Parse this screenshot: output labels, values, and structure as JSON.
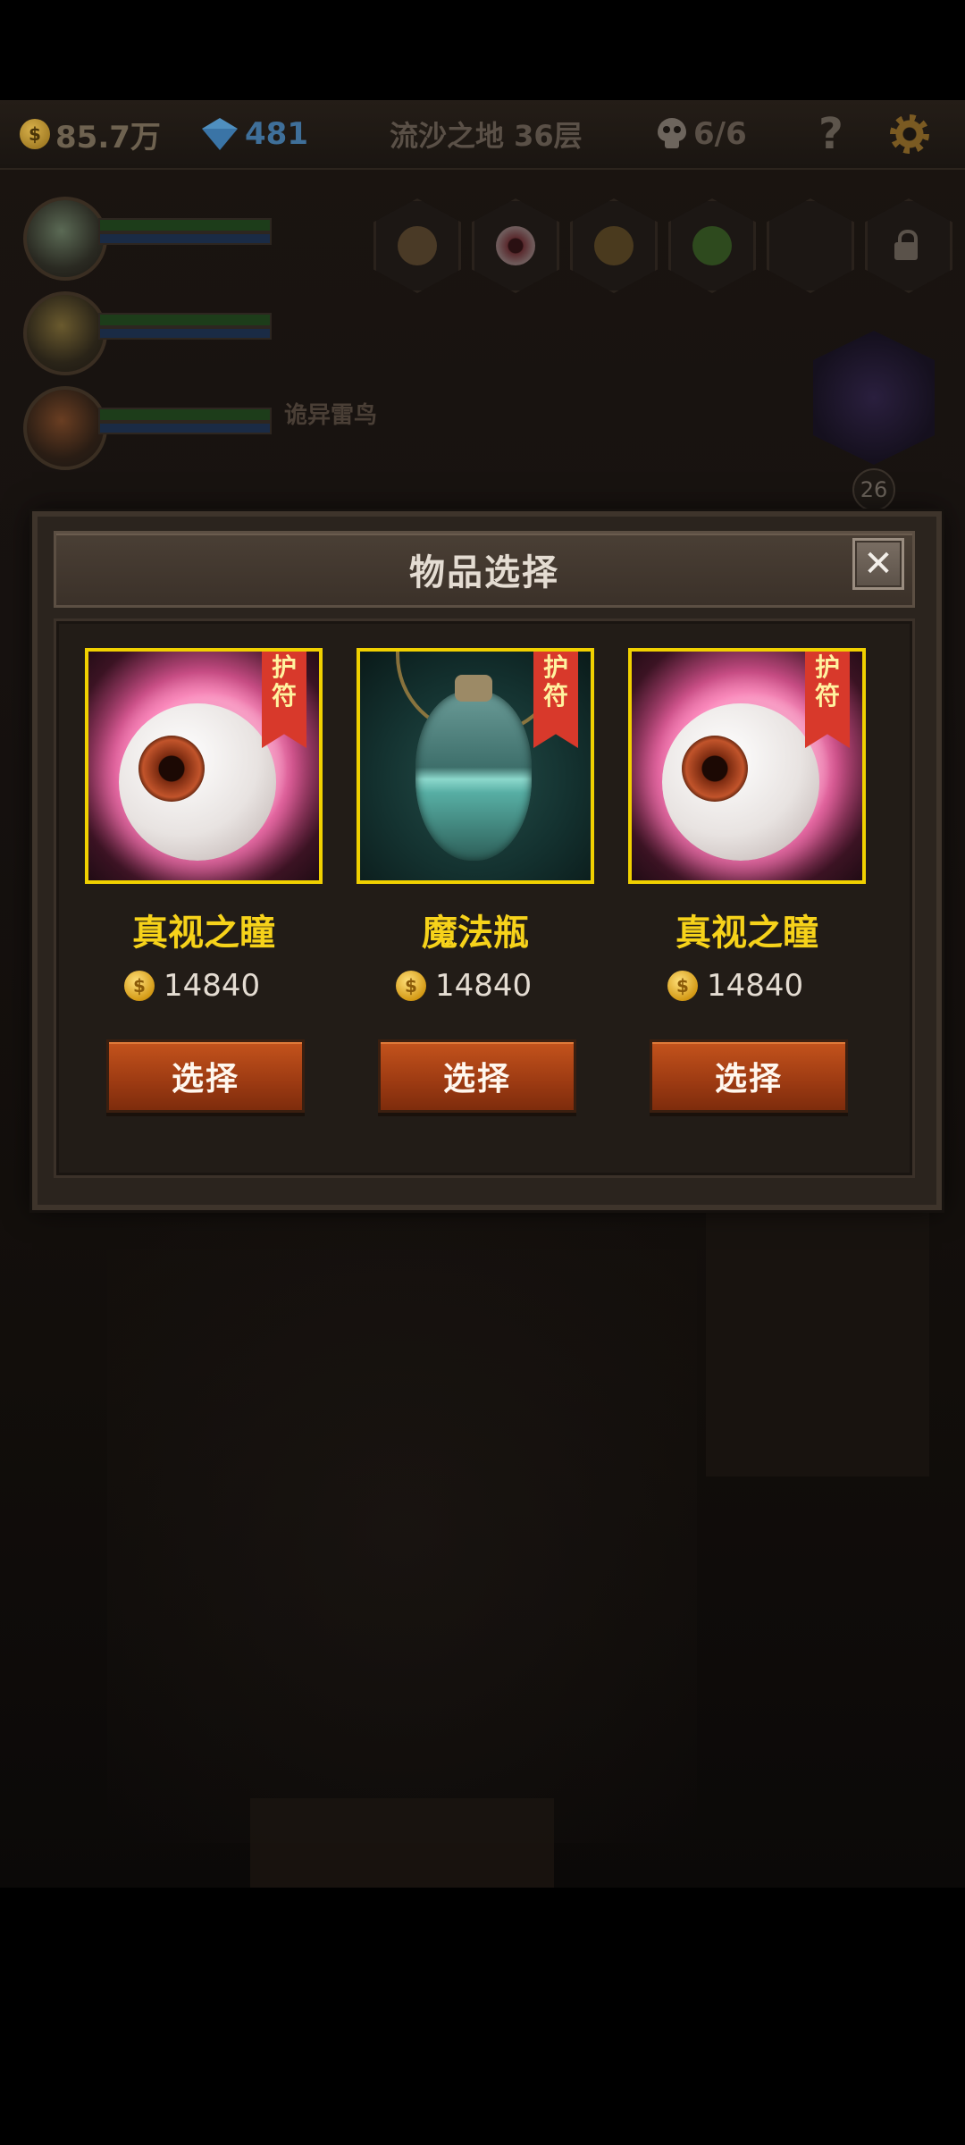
{
  "hud": {
    "gold": "85.7万",
    "gems": "481",
    "location": "流沙之地 36层",
    "kills": "6/6",
    "help": "?",
    "coin_glyph": "$"
  },
  "scene": {
    "enemy_name": "诡异雷鸟",
    "boss_level": "26"
  },
  "modal": {
    "title": "物品选择",
    "close": "✕",
    "items": [
      {
        "name": "真视之瞳",
        "tag": [
          "护",
          "符"
        ],
        "price": "14840",
        "button": "选择",
        "art": "eye-icon"
      },
      {
        "name": "魔法瓶",
        "tag": [
          "护",
          "符"
        ],
        "price": "14840",
        "button": "选择",
        "art": "potion-bottle-icon"
      },
      {
        "name": "真视之瞳",
        "tag": [
          "护",
          "符"
        ],
        "price": "14840",
        "button": "选择",
        "art": "eye-icon"
      }
    ]
  },
  "colors": {
    "item_name": "#f6d21a",
    "frame": "#f0d000",
    "tag": "#d8392b",
    "button": "#9c3a12"
  }
}
